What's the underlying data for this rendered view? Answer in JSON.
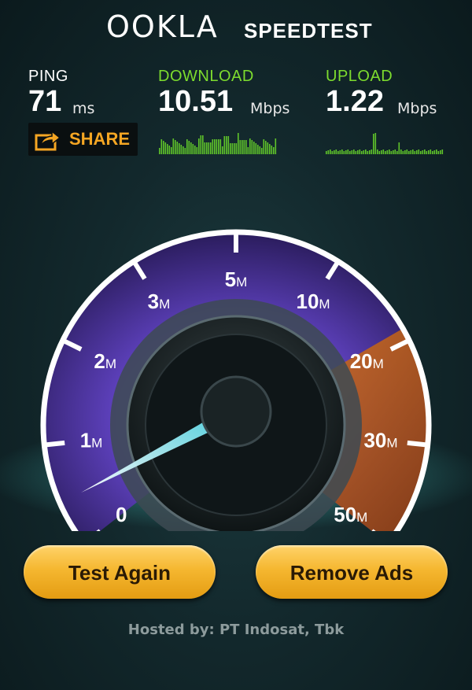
{
  "header": {
    "logo_text": "OOKLA",
    "app_name": "SPEEDTEST"
  },
  "stats": {
    "ping": {
      "label": "PING",
      "value": "71",
      "unit": "ms"
    },
    "download": {
      "label": "DOWNLOAD",
      "value": "10.51",
      "unit": "Mbps",
      "color": "#7ddc2e"
    },
    "upload": {
      "label": "UPLOAD",
      "value": "1.22",
      "unit": "Mbps",
      "color": "#7ddc2e"
    }
  },
  "share": {
    "label": "SHARE",
    "icon": "share-arrow-icon",
    "color": "#f5a623"
  },
  "gauge": {
    "scale_labels": [
      {
        "num": "0",
        "unit": ""
      },
      {
        "num": "1",
        "unit": "M"
      },
      {
        "num": "2",
        "unit": "M"
      },
      {
        "num": "3",
        "unit": "M"
      },
      {
        "num": "5",
        "unit": "M"
      },
      {
        "num": "10",
        "unit": "M"
      },
      {
        "num": "20",
        "unit": "M"
      },
      {
        "num": "30",
        "unit": "M"
      },
      {
        "num": "50",
        "unit": "M"
      }
    ],
    "needle_value_mbps": 0.5,
    "arc_color": "#6b44c9",
    "high_zone_color": "#d86a1d"
  },
  "buttons": {
    "test_again": "Test Again",
    "remove_ads": "Remove Ads"
  },
  "footer": {
    "hosted_by": "Hosted by: PT Indosat, Tbk"
  }
}
